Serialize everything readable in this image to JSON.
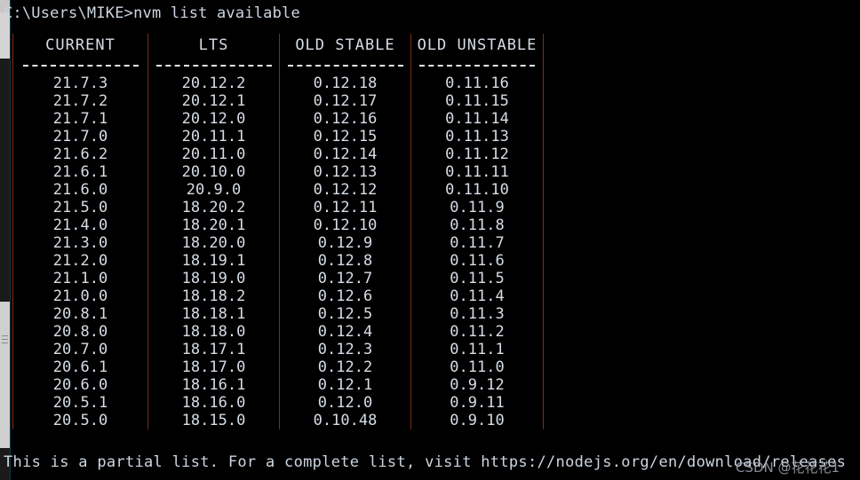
{
  "terminal": {
    "prompt_line": "C:\\Users\\MIKE>nvm list available",
    "footer_note": "This is a partial list. For a complete list, visit https://nodejs.org/en/download/releases",
    "watermark": "CSDN @花花花1",
    "background_color": "#000000",
    "text_color": "#d5dde6",
    "separator_color": "#7a2f12"
  },
  "table": {
    "headers": [
      "CURRENT",
      "LTS",
      "OLD STABLE",
      "OLD UNSTABLE"
    ],
    "rows": [
      [
        "21.7.3",
        "20.12.2",
        "0.12.18",
        "0.11.16"
      ],
      [
        "21.7.2",
        "20.12.1",
        "0.12.17",
        "0.11.15"
      ],
      [
        "21.7.1",
        "20.12.0",
        "0.12.16",
        "0.11.14"
      ],
      [
        "21.7.0",
        "20.11.1",
        "0.12.15",
        "0.11.13"
      ],
      [
        "21.6.2",
        "20.11.0",
        "0.12.14",
        "0.11.12"
      ],
      [
        "21.6.1",
        "20.10.0",
        "0.12.13",
        "0.11.11"
      ],
      [
        "21.6.0",
        "20.9.0",
        "0.12.12",
        "0.11.10"
      ],
      [
        "21.5.0",
        "18.20.2",
        "0.12.11",
        "0.11.9"
      ],
      [
        "21.4.0",
        "18.20.1",
        "0.12.10",
        "0.11.8"
      ],
      [
        "21.3.0",
        "18.20.0",
        "0.12.9",
        "0.11.7"
      ],
      [
        "21.2.0",
        "18.19.1",
        "0.12.8",
        "0.11.6"
      ],
      [
        "21.1.0",
        "18.19.0",
        "0.12.7",
        "0.11.5"
      ],
      [
        "21.0.0",
        "18.18.2",
        "0.12.6",
        "0.11.4"
      ],
      [
        "20.8.1",
        "18.18.1",
        "0.12.5",
        "0.11.3"
      ],
      [
        "20.8.0",
        "18.18.0",
        "0.12.4",
        "0.11.2"
      ],
      [
        "20.7.0",
        "18.17.1",
        "0.12.3",
        "0.11.1"
      ],
      [
        "20.6.1",
        "18.17.0",
        "0.12.2",
        "0.11.0"
      ],
      [
        "20.6.0",
        "18.16.1",
        "0.12.1",
        "0.9.12"
      ],
      [
        "20.5.1",
        "18.16.0",
        "0.12.0",
        "0.9.11"
      ],
      [
        "20.5.0",
        "18.15.0",
        "0.10.48",
        "0.9.10"
      ]
    ]
  }
}
